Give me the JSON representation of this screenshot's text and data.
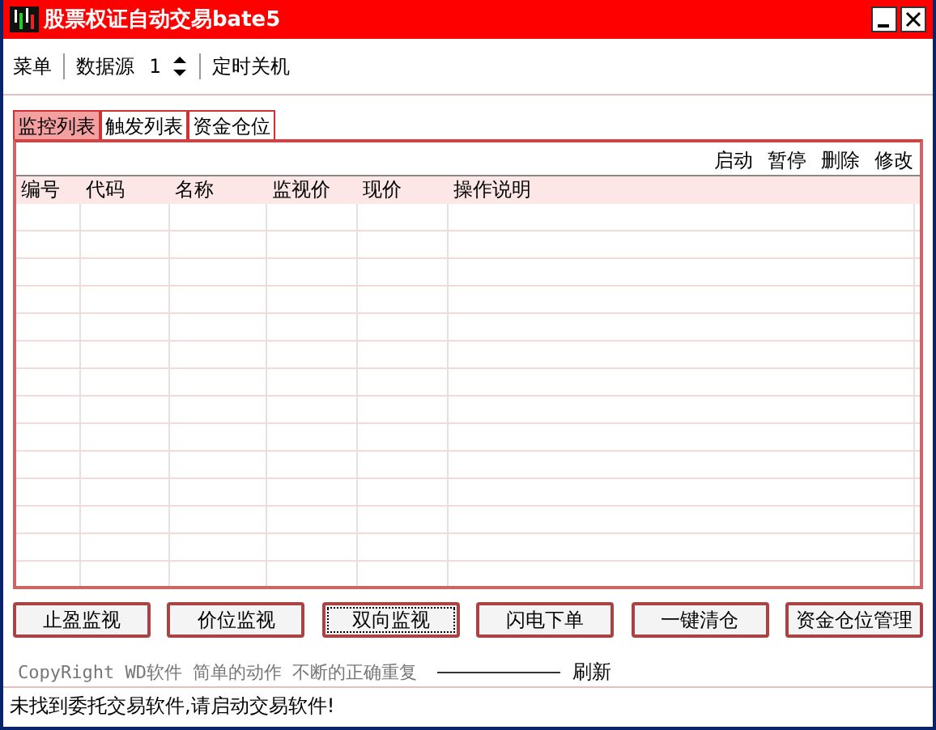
{
  "window": {
    "title": "股票权证自动交易bate5"
  },
  "menu": [
    {
      "label": "菜单"
    },
    {
      "label": "数据源"
    },
    {
      "label": "定时关机"
    }
  ],
  "data_source_value": "1",
  "tabs": [
    {
      "label": "监控列表",
      "selected": true
    },
    {
      "label": "触发列表",
      "selected": false
    },
    {
      "label": "资金仓位",
      "selected": false
    }
  ],
  "actions": [
    "启动",
    "暂停",
    "删除",
    "修改"
  ],
  "table": {
    "columns": [
      "编号",
      "代码",
      "名称",
      "监视价",
      "现价",
      "操作说明"
    ]
  },
  "buttons": [
    {
      "label": "止盈监视",
      "focused": false
    },
    {
      "label": "价位监视",
      "focused": false
    },
    {
      "label": "双向监视",
      "focused": true
    },
    {
      "label": "闪电下单",
      "focused": false
    },
    {
      "label": "一键清仓",
      "focused": false
    },
    {
      "label": "资金仓位管理",
      "focused": false
    }
  ],
  "copyright": "CopyRight WD软件 简单的动作 不断的正确重复",
  "refresh_label": "刷新",
  "status_bar": "未找到委托交易软件,请启动交易软件!"
}
